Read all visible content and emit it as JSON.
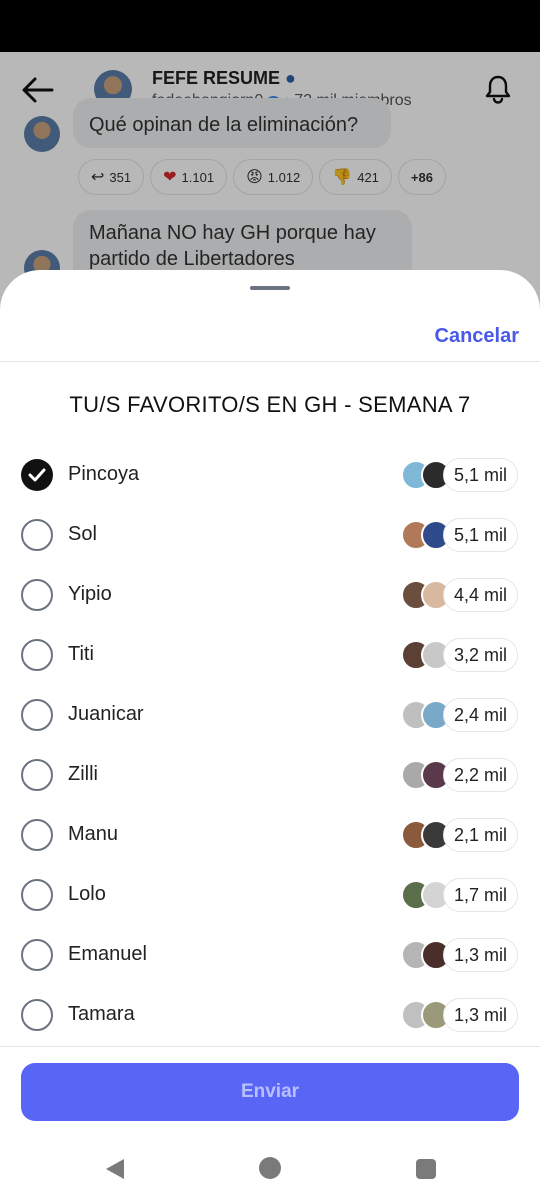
{
  "header": {
    "title": "FEFE RESUME",
    "handle": "fedeebongiorn0",
    "members": "• 72 mil miembros"
  },
  "messages": [
    {
      "text": "Qué opinan de la eliminación?"
    },
    {
      "text": "Mañana NO hay GH porque hay partido de Libertadores"
    }
  ],
  "reactions": [
    {
      "icon": "reply-icon",
      "glyph": "↩",
      "count": "351"
    },
    {
      "icon": "heart-icon",
      "glyph": "❤",
      "count": "1.101"
    },
    {
      "icon": "angry-face-icon",
      "glyph": "😡",
      "count": "1.012"
    },
    {
      "icon": "thumbs-down-icon",
      "glyph": "👎",
      "count": "421"
    },
    {
      "icon": "more-reactions",
      "glyph": "",
      "count": "+86"
    }
  ],
  "sheet": {
    "cancel_label": "Cancelar",
    "title": "TU/S FAVORITO/S EN GH - SEMANA 7",
    "send_label": "Enviar"
  },
  "options": [
    {
      "label": "Pincoya",
      "votes": "5,1 mil",
      "selected": true,
      "avatar_colors": [
        "#7fb8d6",
        "#2b2b2b"
      ]
    },
    {
      "label": "Sol",
      "votes": "5,1 mil",
      "selected": false,
      "avatar_colors": [
        "#b07a5a",
        "#2e4a8a"
      ]
    },
    {
      "label": "Yipio",
      "votes": "4,4 mil",
      "selected": false,
      "avatar_colors": [
        "#6a4e3e",
        "#d9b8a0"
      ]
    },
    {
      "label": "Titi",
      "votes": "3,2 mil",
      "selected": false,
      "avatar_colors": [
        "#5c4034",
        "#c8c8c8"
      ]
    },
    {
      "label": "Juanicar",
      "votes": "2,4 mil",
      "selected": false,
      "avatar_colors": [
        "#bfbfbf",
        "#7aa8c9"
      ]
    },
    {
      "label": "Zilli",
      "votes": "2,2 mil",
      "selected": false,
      "avatar_colors": [
        "#a9a9a9",
        "#5a3a4a"
      ]
    },
    {
      "label": "Manu",
      "votes": "2,1 mil",
      "selected": false,
      "avatar_colors": [
        "#8a5a3c",
        "#3a3a3a"
      ]
    },
    {
      "label": "Lolo",
      "votes": "1,7 mil",
      "selected": false,
      "avatar_colors": [
        "#5a6e4a",
        "#d4d4d4"
      ]
    },
    {
      "label": "Emanuel",
      "votes": "1,3 mil",
      "selected": false,
      "avatar_colors": [
        "#b5b5b5",
        "#4a2e2a"
      ]
    },
    {
      "label": "Tamara",
      "votes": "1,3 mil",
      "selected": false,
      "avatar_colors": [
        "#c0c0c0",
        "#9a9a7a"
      ]
    }
  ],
  "colors": {
    "accent": "#4a5ae8",
    "send_button": "#5865f5"
  }
}
